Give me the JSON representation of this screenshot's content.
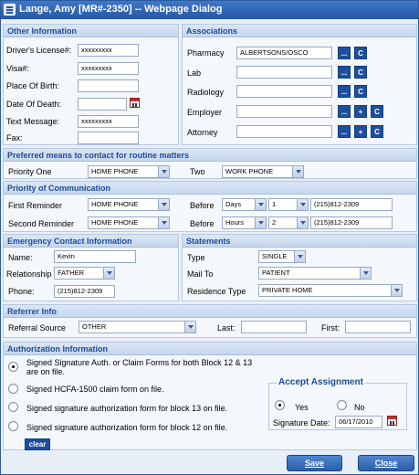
{
  "window": {
    "title": "Lange, Amy [MR#-2350] -- Webpage Dialog"
  },
  "other_info": {
    "title": "Other Information",
    "drivers_license_label": "Driver's License#:",
    "drivers_license": "xxxxxxxxx",
    "visa_label": "Visa#:",
    "visa": "xxxxxxxxx",
    "place_of_birth_label": "Place Of Birth:",
    "place_of_birth": "",
    "date_of_death_label": "Date Of Death:",
    "date_of_death": "",
    "text_message_label": "Text Message:",
    "text_message": "xxxxxxxxx",
    "fax_label": "Fax:",
    "fax": ""
  },
  "associations": {
    "title": "Associations",
    "pharmacy_label": "Pharmacy",
    "pharmacy": "ALBERTSONS/OSCO",
    "lab_label": "Lab",
    "lab": "",
    "radiology_label": "Radiology",
    "radiology": "",
    "employer_label": "Employer",
    "employer": "",
    "attorney_label": "Attorney",
    "attorney": "",
    "dots": "...",
    "plus": "+",
    "c": "C"
  },
  "preferred": {
    "title": "Preferred means to contact for routine matters",
    "priority_one_label": "Priority One",
    "priority_one": "HOME PHONE",
    "two_label": "Two",
    "two": "WORK PHONE"
  },
  "priority_comm": {
    "title": "Priority of Communication",
    "first_label": "First Reminder",
    "first": "HOME PHONE",
    "before_label": "Before",
    "first_unit": "Days",
    "first_num": "1",
    "first_phone": "(215)812-2309",
    "second_label": "Second Reminder",
    "second": "HOME PHONE",
    "second_unit": "Hours",
    "second_num": "2",
    "second_phone": "(215)812-2309"
  },
  "emergency": {
    "title": "Emergency Contact Information",
    "name_label": "Name:",
    "name": "Kevin",
    "relationship_label": "Relationship",
    "relationship": "FATHER",
    "phone_label": "Phone:",
    "phone": "(215)812-2309"
  },
  "statements": {
    "title": "Statements",
    "type_label": "Type",
    "type": "SINGLE",
    "mail_to_label": "Mail To",
    "mail_to": "PATIENT",
    "residence_label": "Residence Type",
    "residence": "PRIVATE HOME"
  },
  "referrer": {
    "title": "Referrer Info",
    "source_label": "Referral Source",
    "source": "OTHER",
    "last_label": "Last:",
    "last": "",
    "first_label": "First:",
    "first": ""
  },
  "authorization": {
    "title": "Authorization Information",
    "opt1": "Signed Signature Auth. or Claim Forms for both Block 12 & 13 are on file.",
    "opt2": "Signed HCFA-1500 claim form on file.",
    "opt3": "Signed signature authorization form for block 13 on file.",
    "opt4": "Signed signature authorization form for block 12 on file.",
    "clear": "clear",
    "accept_title": "Accept Assignment",
    "yes": "Yes",
    "no": "No",
    "signature_date_label": "Signature Date:",
    "signature_date": "06/17/2010"
  },
  "footer": {
    "save": "Save",
    "close": "Close"
  }
}
